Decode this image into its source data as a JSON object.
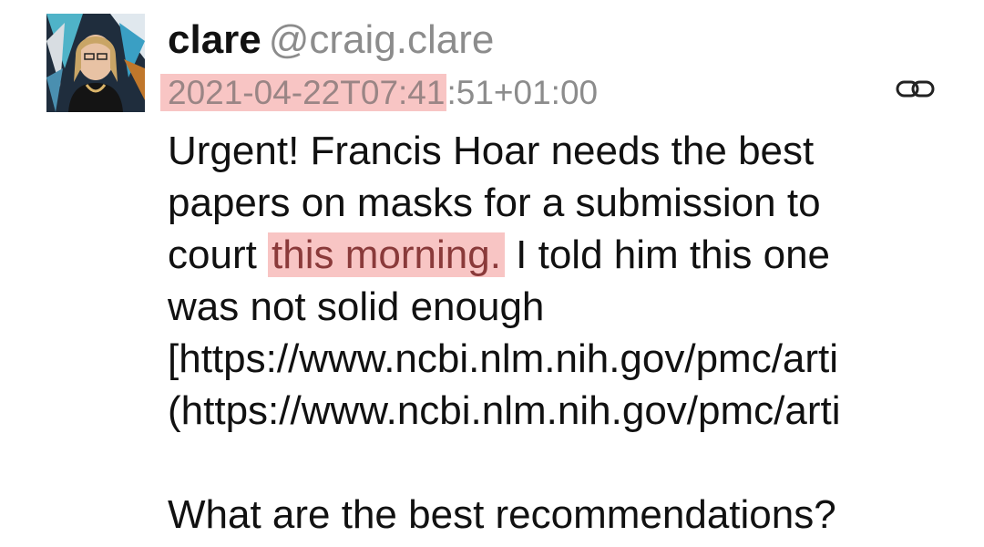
{
  "post": {
    "display_name": "clare",
    "handle": "@craig.clare",
    "timestamp_highlighted": "2021-04-22T07:41",
    "timestamp_rest": ":51+01:00",
    "link_icon": "link-icon",
    "body": {
      "line1": "Urgent! Francis Hoar needs the best",
      "line2": "papers on masks for a submission to",
      "line3_before": "court ",
      "line3_highlight": "this morning.",
      "line3_after": " I told him this one",
      "line4": "was not solid enough",
      "line5": "[https://www.ncbi.nlm.nih.gov/pmc/arti",
      "line6": "(https://www.ncbi.nlm.nih.gov/pmc/arti",
      "line7": "What are the best recommendations?"
    }
  },
  "colors": {
    "highlight": "#f8c5c4",
    "muted_text": "#8c8c8c",
    "text": "#111111"
  }
}
